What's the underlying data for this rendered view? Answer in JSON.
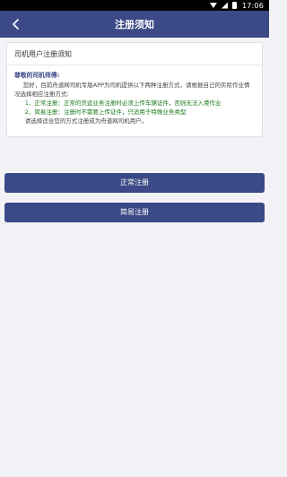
{
  "status_bar": {
    "time": "17:06"
  },
  "nav": {
    "title": "注册须知"
  },
  "notice": {
    "title": "司机用户注册须知",
    "greeting": "尊敬的司机师傅:",
    "intro": "您好，目前舟道网司机专版APP为司机提供以下两种注册方式，请根据自己的实际作业情况选择相应注册方式:",
    "options": [
      "1、正常注册：正常的货运业务注册时必须上传车辆证件，否则无法入港作业",
      "2、简易注册：注册时不需要上传证件，只适用于特殊业务类型"
    ],
    "closing": "请选择适合您的方式注册成为舟道网司机用户。"
  },
  "buttons": {
    "normal": "正常注册",
    "simple": "简易注册"
  }
}
